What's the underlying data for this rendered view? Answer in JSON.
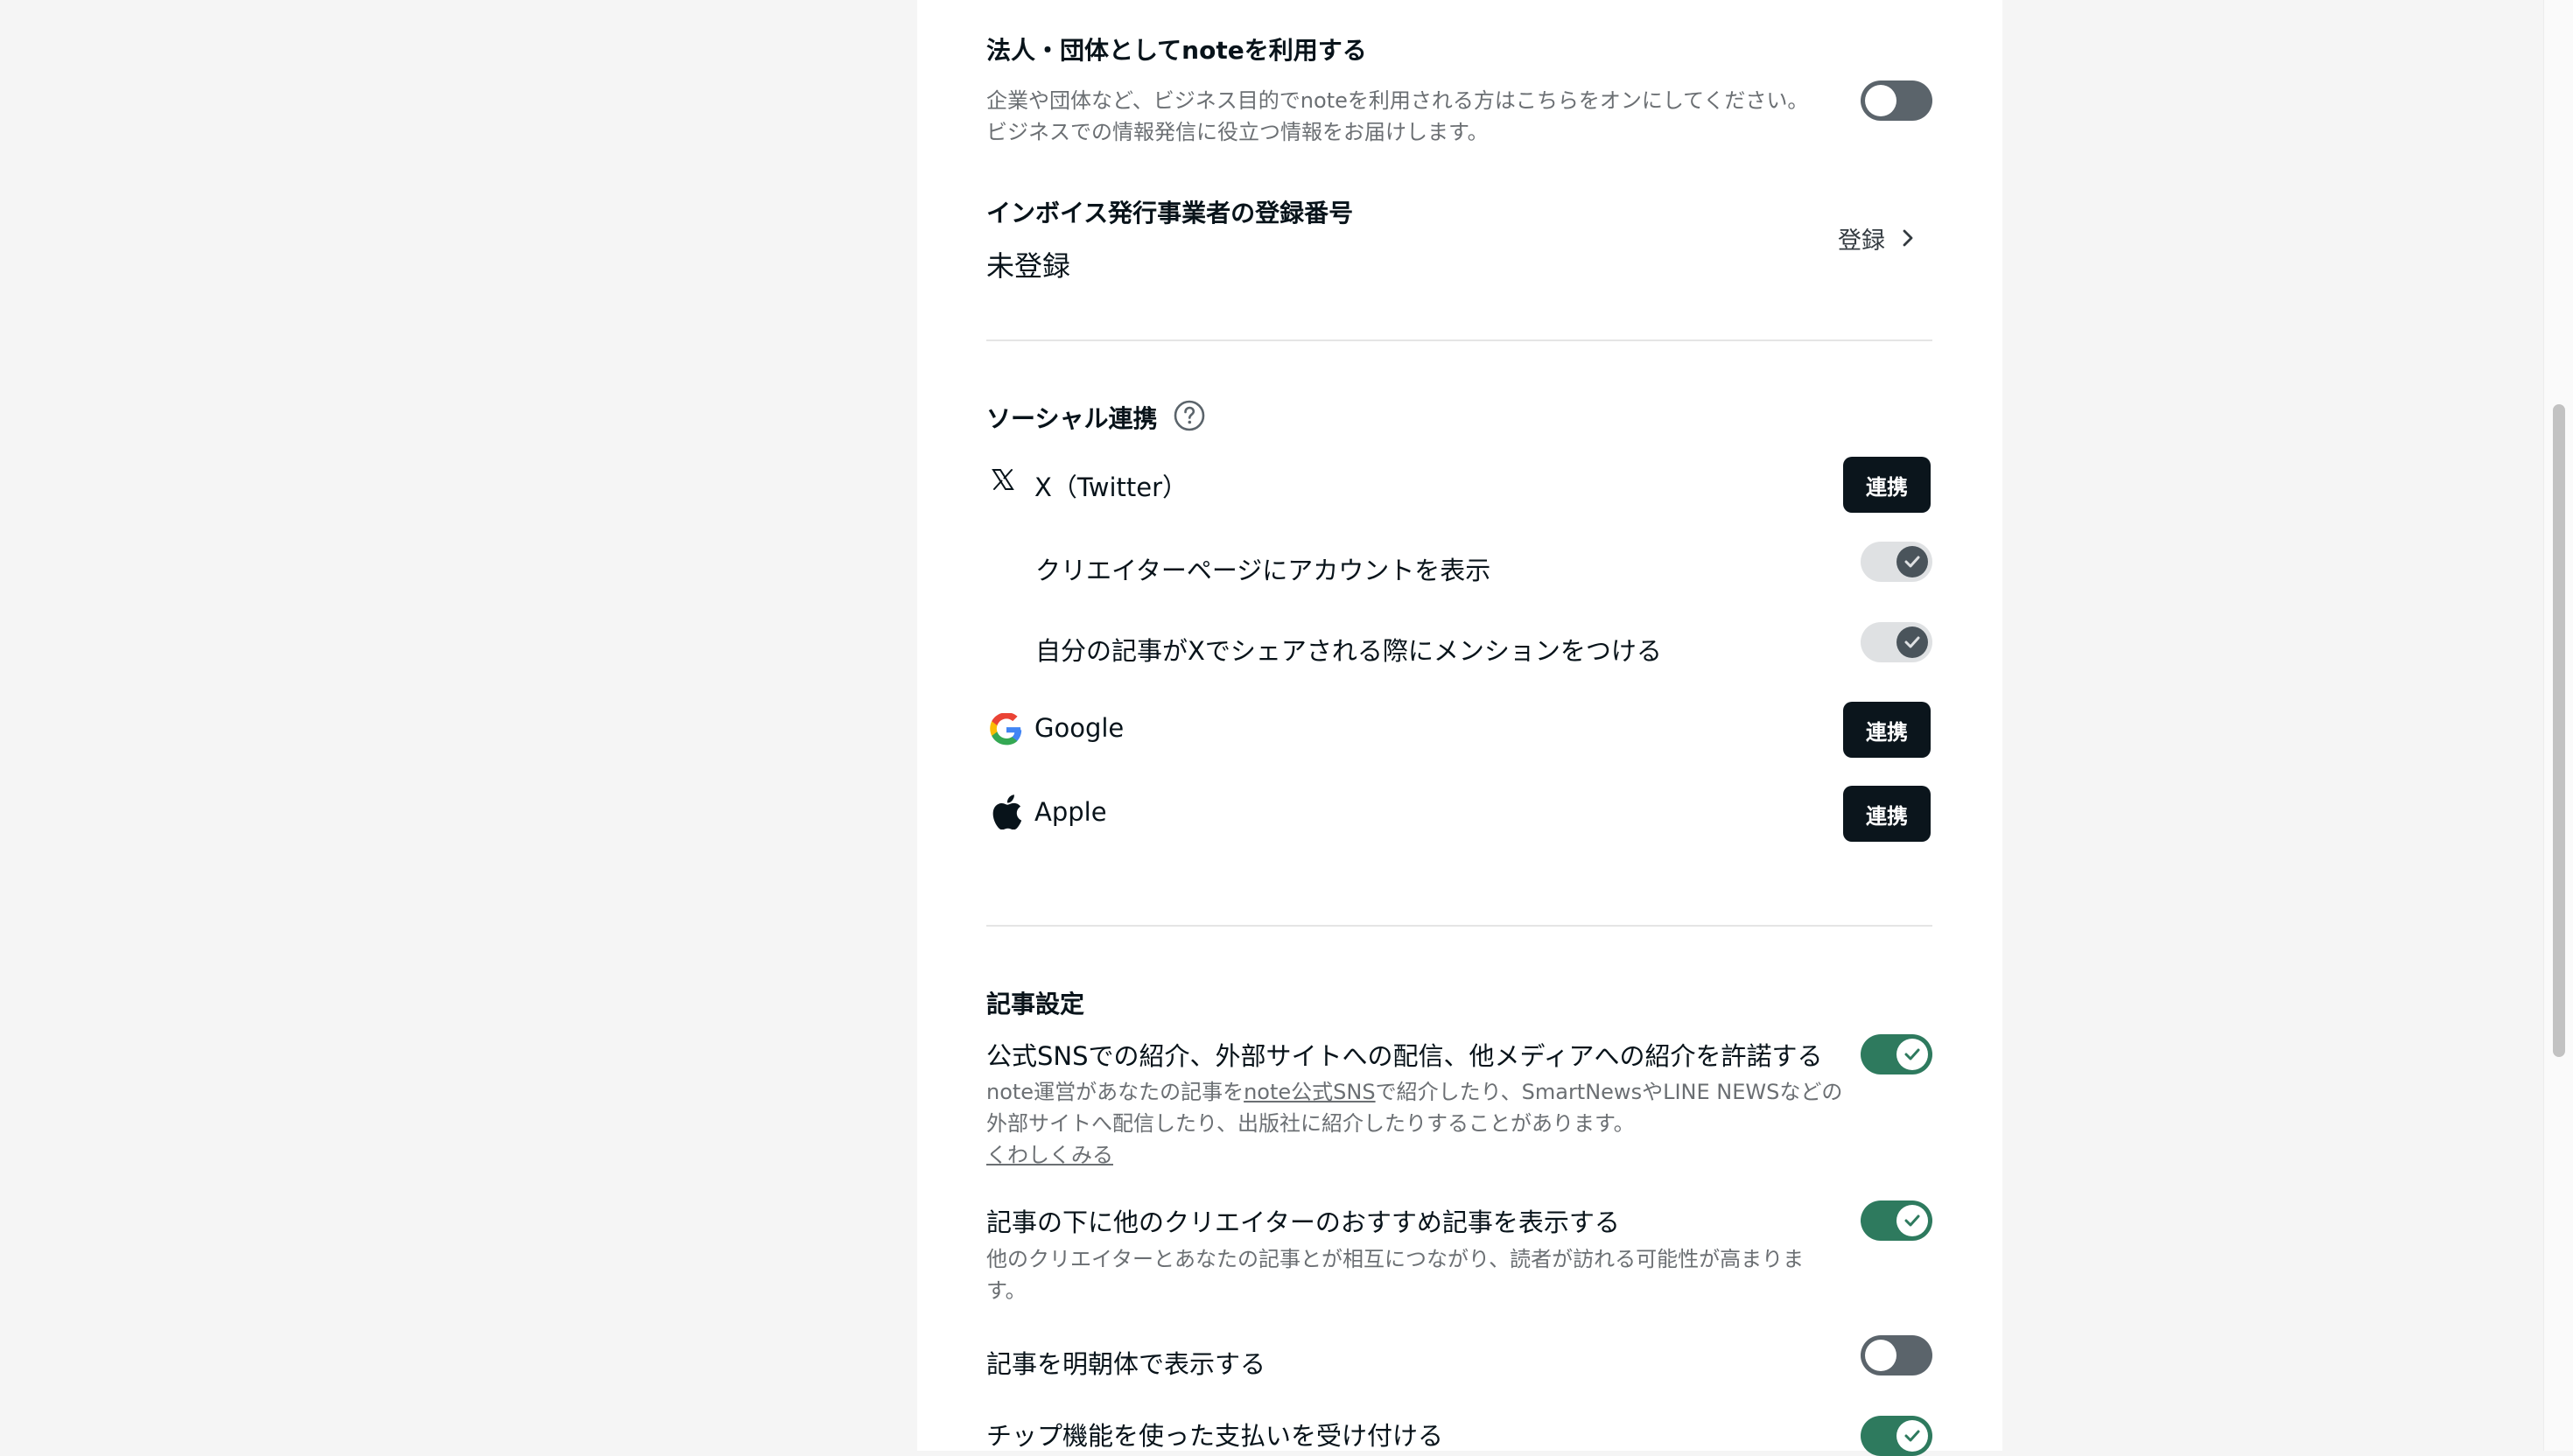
{
  "corporate": {
    "title": "法人・団体としてnoteを利用する",
    "desc_line1": "企業や団体など、ビジネス目的でnoteを利用される方はこちらをオンにしてください。",
    "desc_line2": "ビジネスでの情報発信に役立つ情報をお届けします。",
    "toggle_on": false
  },
  "invoice": {
    "title": "インボイス発行事業者の登録番号",
    "value": "未登録",
    "action_label": "登録"
  },
  "social": {
    "title": "ソーシャル連携",
    "twitter": {
      "label": "X（Twitter）",
      "button": "連携",
      "option1": "クリエイターページにアカウントを表示",
      "option2": "自分の記事がXでシェアされる際にメンションをつける"
    },
    "google": {
      "label": "Google",
      "button": "連携"
    },
    "apple": {
      "label": "Apple",
      "button": "連携"
    }
  },
  "article": {
    "title": "記事設定",
    "allow_intro": {
      "label": "公式SNSでの紹介、外部サイトへの配信、他メディアへの紹介を許諾する",
      "desc_part1": "note運営があなたの記事を",
      "desc_link": "note公式SNS",
      "desc_part2": "で紹介したり、SmartNewsやLINE NEWSなどの",
      "desc_line2": "外部サイトへ配信したり、出版社に紹介したりすることがあります。",
      "more_link": "くわしくみる",
      "toggle_on": true
    },
    "recommend": {
      "label": "記事の下に他のクリエイターのおすすめ記事を表示する",
      "desc_line1": "他のクリエイターとあなたの記事とが相互につながり、読者が訪れる可能性が高まりま",
      "desc_line2": "す。",
      "toggle_on": true
    },
    "mincho": {
      "label": "記事を明朝体で表示する",
      "toggle_on": false
    },
    "tip": {
      "label": "チップ機能を使った支払いを受け付ける",
      "toggle_on": true
    }
  }
}
